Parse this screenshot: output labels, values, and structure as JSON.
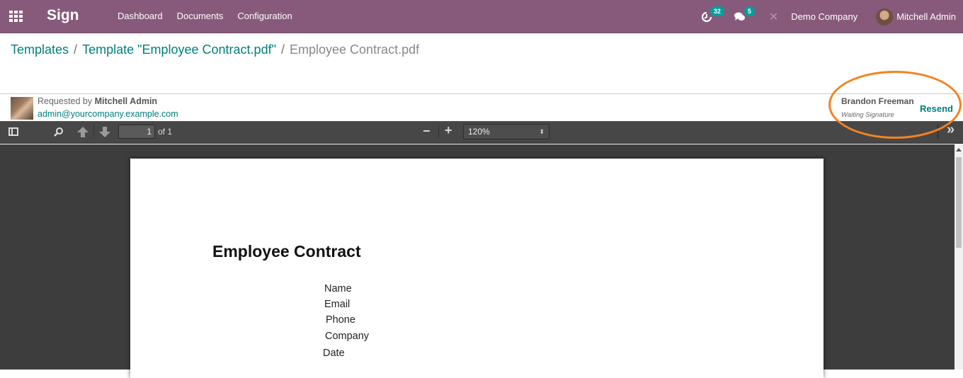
{
  "navbar": {
    "app_name": "Sign",
    "menu": [
      "Dashboard",
      "Documents",
      "Configuration"
    ],
    "activity_count": "32",
    "messages_count": "5",
    "company": "Demo Company",
    "user": "Mitchell Admin",
    "brand_color": "#875a7b",
    "badge_color": "#00a09d"
  },
  "breadcrumb": {
    "items": [
      "Templates",
      "Template \"Employee Contract.pdf\""
    ],
    "separator": "/",
    "current": "Employee Contract.pdf"
  },
  "request": {
    "requested_by_label": "Requested by",
    "requested_by_name": "Mitchell Admin",
    "email": "admin@yourcompany.example.com"
  },
  "signer": {
    "name": "Brandon Freeman",
    "status": "Waiting Signature",
    "action": "Resend"
  },
  "pdf_toolbar": {
    "page_number": "1",
    "page_total_label": "of 1",
    "zoom_level": "120%",
    "zoom_out": "−",
    "zoom_in": "+",
    "more": "»"
  },
  "document": {
    "title": "Employee Contract",
    "fields": [
      "Name",
      "Email",
      "Phone",
      "Company",
      "Date"
    ]
  }
}
